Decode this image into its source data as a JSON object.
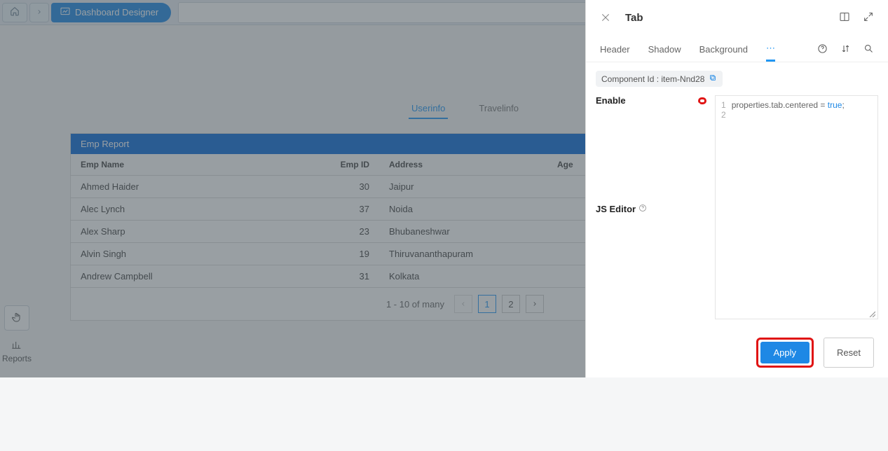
{
  "breadcrumb": {
    "page": "Dashboard Designer"
  },
  "leftTools": {
    "reportsLabel": "Reports"
  },
  "reportTabs": [
    "Userinfo",
    "Travelinfo"
  ],
  "empReport": {
    "title": "Emp Report",
    "columns": [
      "Emp Name",
      "Emp ID",
      "Address",
      "Age"
    ],
    "rows": [
      {
        "name": "Ahmed Haider",
        "id": 30,
        "address": "Jaipur"
      },
      {
        "name": "Alec Lynch",
        "id": 37,
        "address": "Noida"
      },
      {
        "name": "Alex Sharp",
        "id": 23,
        "address": "Bhubaneshwar"
      },
      {
        "name": "Alvin Singh",
        "id": 19,
        "address": "Thiruvananthapuram"
      },
      {
        "name": "Andrew Campbell",
        "id": 31,
        "address": "Kolkata"
      }
    ],
    "pager": {
      "info": "1 - 10 of many",
      "pages": [
        "1",
        "2"
      ]
    }
  },
  "sidePanel": {
    "title": "Tab",
    "tabs": [
      "Header",
      "Shadow",
      "Background"
    ],
    "componentId": "Component Id : item-Nnd28",
    "enableLabel": "Enable",
    "jsEditorLabel": "JS Editor",
    "code": {
      "line1a": "properties.tab.centered = ",
      "line1b": "true",
      "line1c": ";"
    },
    "applyLabel": "Apply",
    "resetLabel": "Reset"
  }
}
